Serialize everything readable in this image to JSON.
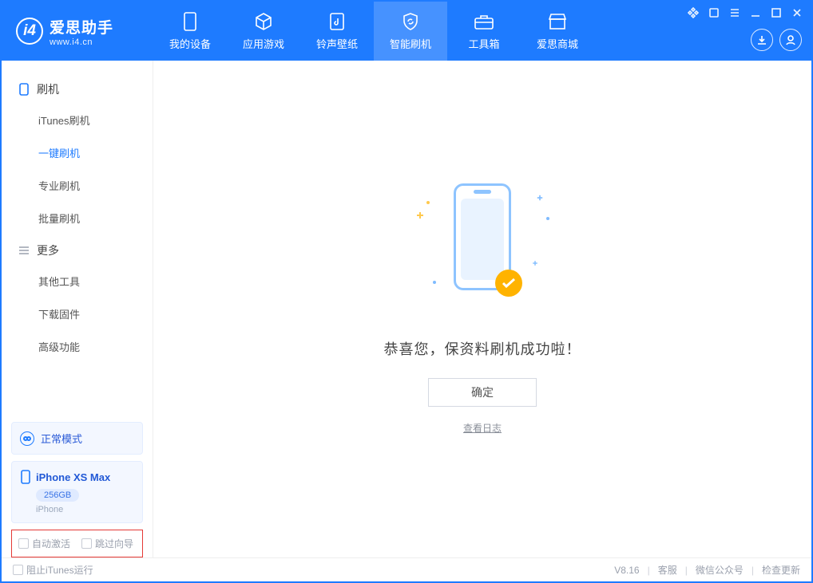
{
  "brand": {
    "name": "爱思助手",
    "url": "www.i4.cn"
  },
  "nav": {
    "items": [
      {
        "label": "我的设备"
      },
      {
        "label": "应用游戏"
      },
      {
        "label": "铃声壁纸"
      },
      {
        "label": "智能刷机"
      },
      {
        "label": "工具箱"
      },
      {
        "label": "爱思商城"
      }
    ],
    "active_index": 3
  },
  "sidebar": {
    "section1": {
      "title": "刷机",
      "items": [
        "iTunes刷机",
        "一键刷机",
        "专业刷机",
        "批量刷机"
      ],
      "active_index": 1
    },
    "section2": {
      "title": "更多",
      "items": [
        "其他工具",
        "下载固件",
        "高级功能"
      ]
    }
  },
  "mode": {
    "label": "正常模式"
  },
  "device": {
    "name": "iPhone XS Max",
    "capacity": "256GB",
    "type": "iPhone"
  },
  "options": {
    "auto_activate": "自动激活",
    "skip_guide": "跳过向导"
  },
  "result": {
    "message": "恭喜您，保资料刷机成功啦！",
    "ok_label": "确定",
    "log_link": "查看日志"
  },
  "footer": {
    "block_itunes": "阻止iTunes运行",
    "version": "V8.16",
    "links": [
      "客服",
      "微信公众号",
      "检查更新"
    ]
  }
}
